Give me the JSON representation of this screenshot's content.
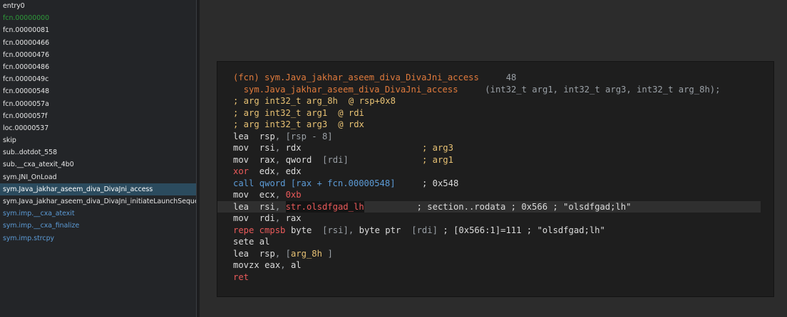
{
  "sidebar": {
    "items": [
      {
        "label": "entry0",
        "color": "#e6e6e6"
      },
      {
        "label": "fcn.00000000",
        "color": "#2e9b3a"
      },
      {
        "label": "fcn.00000081",
        "color": "#e6e6e6"
      },
      {
        "label": "fcn.00000466",
        "color": "#e6e6e6"
      },
      {
        "label": "fcn.00000476",
        "color": "#e6e6e6"
      },
      {
        "label": "fcn.00000486",
        "color": "#e6e6e6"
      },
      {
        "label": "fcn.0000049c",
        "color": "#e6e6e6"
      },
      {
        "label": "fcn.00000548",
        "color": "#e6e6e6"
      },
      {
        "label": "fcn.0000057a",
        "color": "#e6e6e6"
      },
      {
        "label": "fcn.0000057f",
        "color": "#e6e6e6"
      },
      {
        "label": "loc.00000537",
        "color": "#e6e6e6"
      },
      {
        "label": "skip",
        "color": "#e6e6e6"
      },
      {
        "label": "sub..dotdot_558",
        "color": "#e6e6e6"
      },
      {
        "label": "sub.__cxa_atexit_4b0",
        "color": "#e6e6e6"
      },
      {
        "label": "sym.JNI_OnLoad",
        "color": "#e6e6e6"
      },
      {
        "label": "sym.Java_jakhar_aseem_diva_DivaJni_access",
        "color": "#ffffff",
        "selected": true
      },
      {
        "label": "sym.Java_jakhar_aseem_diva_DivaJni_initiateLaunchSequence",
        "color": "#e6e6e6"
      },
      {
        "label": "sym.imp.__cxa_atexit",
        "color": "#5c9bd6"
      },
      {
        "label": "sym.imp.__cxa_finalize",
        "color": "#5c9bd6"
      },
      {
        "label": "sym.imp.strcpy",
        "color": "#5c9bd6"
      }
    ]
  },
  "disasm": {
    "lines": [
      {
        "tokens": [
          {
            "text": "(fcn) sym.Java_jakhar_aseem_diva_DivaJni_access",
            "cls": "orange",
            "col": 0
          },
          {
            "text": "48",
            "cls": "gray",
            "col": 52
          }
        ]
      },
      {
        "tokens": [
          {
            "text": "sym.Java_jakhar_aseem_diva_DivaJni_access",
            "cls": "orange",
            "col": 2
          },
          {
            "text": "(int32_t arg1, int32_t arg3, int32_t arg_8h);",
            "cls": "gray",
            "col": 48
          }
        ]
      },
      {
        "tokens": [
          {
            "text": "; arg",
            "cls": "yellow",
            "col": 0
          },
          {
            "text": "int32_t arg_8h",
            "cls": "yellow",
            "col": 6
          },
          {
            "text": "@ rsp+0x8",
            "cls": "yellow",
            "col": 22
          }
        ]
      },
      {
        "tokens": [
          {
            "text": "; arg",
            "cls": "yellow",
            "col": 0
          },
          {
            "text": "int32_t arg1",
            "cls": "yellow",
            "col": 6
          },
          {
            "text": "@ rdi",
            "cls": "yellow",
            "col": 20
          }
        ]
      },
      {
        "tokens": [
          {
            "text": "; arg",
            "cls": "yellow",
            "col": 0
          },
          {
            "text": "int32_t arg3",
            "cls": "yellow",
            "col": 6
          },
          {
            "text": "@ rdx",
            "cls": "yellow",
            "col": 20
          }
        ]
      },
      {
        "tokens": [
          {
            "text": "lea",
            "cls": "white",
            "col": 0
          },
          {
            "text": "rsp",
            "cls": "white",
            "col": 5
          },
          {
            "text": ",",
            "cls": "gray",
            "col": 8
          },
          {
            "text": "[rsp - 8]",
            "cls": "gray",
            "col": 10
          }
        ]
      },
      {
        "tokens": [
          {
            "text": "mov",
            "cls": "white",
            "col": 0
          },
          {
            "text": "rsi",
            "cls": "white",
            "col": 5
          },
          {
            "text": ",",
            "cls": "gray",
            "col": 8
          },
          {
            "text": "rdx",
            "cls": "white",
            "col": 10
          },
          {
            "text": "; arg3",
            "cls": "yellow",
            "col": 36
          }
        ]
      },
      {
        "tokens": [
          {
            "text": "mov",
            "cls": "white",
            "col": 0
          },
          {
            "text": "rax",
            "cls": "white",
            "col": 5
          },
          {
            "text": ",",
            "cls": "gray",
            "col": 8
          },
          {
            "text": "qword",
            "cls": "white",
            "col": 10
          },
          {
            "text": "[rdi]",
            "cls": "gray",
            "col": 17
          },
          {
            "text": "; arg1",
            "cls": "yellow",
            "col": 36
          }
        ]
      },
      {
        "tokens": [
          {
            "text": "xor",
            "cls": "red",
            "col": 0
          },
          {
            "text": "edx",
            "cls": "white",
            "col": 5
          },
          {
            "text": ",",
            "cls": "gray",
            "col": 8
          },
          {
            "text": "edx",
            "cls": "white",
            "col": 10
          }
        ]
      },
      {
        "tokens": [
          {
            "text": "call",
            "cls": "blue",
            "col": 0
          },
          {
            "text": "qword [rax + fcn.00000548]",
            "cls": "blue",
            "col": 5
          },
          {
            "text": "; 0x548",
            "cls": "white",
            "col": 36
          }
        ]
      },
      {
        "tokens": [
          {
            "text": "mov",
            "cls": "white",
            "col": 0
          },
          {
            "text": "ecx",
            "cls": "white",
            "col": 5
          },
          {
            "text": ",",
            "cls": "gray",
            "col": 8
          },
          {
            "text": "0xb",
            "cls": "red",
            "col": 10
          }
        ]
      },
      {
        "highlight": true,
        "tokens": [
          {
            "text": "lea",
            "cls": "white",
            "col": 0
          },
          {
            "text": "rsi",
            "cls": "white",
            "col": 5
          },
          {
            "text": ",",
            "cls": "gray",
            "col": 8
          },
          {
            "text": "str.olsdfgad_lh",
            "cls": "red",
            "col": 10,
            "selected": true
          },
          {
            "text": "; section..rodata ; 0x566 ; \"olsdfgad;lh\"",
            "cls": "white",
            "col": 35
          }
        ]
      },
      {
        "tokens": [
          {
            "text": "mov",
            "cls": "white",
            "col": 0
          },
          {
            "text": "rdi",
            "cls": "white",
            "col": 5
          },
          {
            "text": ",",
            "cls": "gray",
            "col": 8
          },
          {
            "text": "rax",
            "cls": "white",
            "col": 10
          }
        ]
      },
      {
        "tokens": [
          {
            "text": "repe cmpsb",
            "cls": "red",
            "col": 0
          },
          {
            "text": "byte",
            "cls": "white",
            "col": 11
          },
          {
            "text": "[rsi]",
            "cls": "gray",
            "col": 17
          },
          {
            "text": ",",
            "cls": "gray",
            "col": 22
          },
          {
            "text": "byte ptr",
            "cls": "white",
            "col": 24
          },
          {
            "text": "[rdi]",
            "cls": "gray",
            "col": 34
          },
          {
            "text": "; [0x566:1]=111 ; \"olsdfgad;lh\"",
            "cls": "white",
            "col": 40
          }
        ]
      },
      {
        "tokens": [
          {
            "text": "sete",
            "cls": "white",
            "col": 0
          },
          {
            "text": "al",
            "cls": "white",
            "col": 5
          }
        ]
      },
      {
        "tokens": [
          {
            "text": "lea",
            "cls": "white",
            "col": 0
          },
          {
            "text": "rsp",
            "cls": "white",
            "col": 5
          },
          {
            "text": ",",
            "cls": "gray",
            "col": 8
          },
          {
            "text": "[",
            "cls": "gray",
            "col": 10
          },
          {
            "text": "arg_8h",
            "cls": "yellow",
            "col": 11
          },
          {
            "text": "]",
            "cls": "gray",
            "col": 18
          }
        ]
      },
      {
        "tokens": [
          {
            "text": "movzx",
            "cls": "white",
            "col": 0
          },
          {
            "text": "eax",
            "cls": "white",
            "col": 6
          },
          {
            "text": ",",
            "cls": "gray",
            "col": 9
          },
          {
            "text": "al",
            "cls": "white",
            "col": 11
          }
        ]
      },
      {
        "tokens": [
          {
            "text": "ret",
            "cls": "red",
            "col": 0
          }
        ]
      }
    ]
  }
}
